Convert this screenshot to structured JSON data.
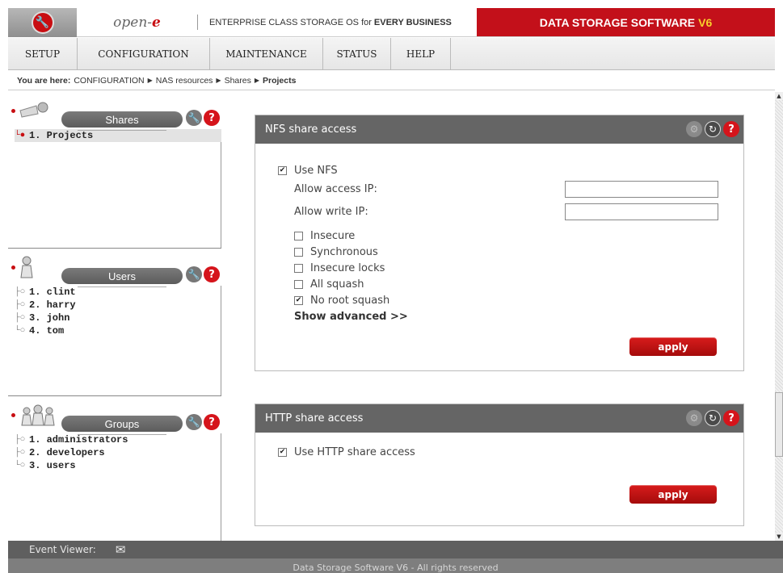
{
  "header": {
    "brand_text": "open-",
    "brand_e": "e",
    "tagline_prefix": "ENTERPRISE CLASS STORAGE OS for",
    "tagline_bold": "EVERY BUSINESS",
    "product": "DATA STORAGE SOFTWARE",
    "product_version": "V6"
  },
  "nav": {
    "items": [
      {
        "label": "SETUP"
      },
      {
        "label": "CONFIGURATION"
      },
      {
        "label": "MAINTENANCE"
      },
      {
        "label": "STATUS"
      },
      {
        "label": "HELP"
      }
    ]
  },
  "breadcrumb": {
    "prefix": "You are here:",
    "items": [
      "CONFIGURATION",
      "NAS resources",
      "Shares",
      "Projects"
    ]
  },
  "sidebar": {
    "shares": {
      "title": "Shares",
      "items": [
        {
          "label": "1. Projects"
        }
      ]
    },
    "users": {
      "title": "Users",
      "items": [
        {
          "label": "1. clint"
        },
        {
          "label": "2. harry"
        },
        {
          "label": "3. john"
        },
        {
          "label": "4. tom"
        }
      ]
    },
    "groups": {
      "title": "Groups",
      "items": [
        {
          "label": "1. administrators"
        },
        {
          "label": "2. developers"
        },
        {
          "label": "3. users"
        }
      ]
    }
  },
  "nfs": {
    "title": "NFS share access",
    "use_nfs": {
      "label": "Use NFS",
      "checked": true
    },
    "allow_access_ip": {
      "label": "Allow access IP:",
      "value": ""
    },
    "allow_write_ip": {
      "label": "Allow write IP:",
      "value": ""
    },
    "options": [
      {
        "label": "Insecure",
        "checked": false
      },
      {
        "label": "Synchronous",
        "checked": false
      },
      {
        "label": "Insecure locks",
        "checked": false
      },
      {
        "label": "All squash",
        "checked": false
      },
      {
        "label": "No root squash",
        "checked": true
      }
    ],
    "show_advanced": "Show advanced >>",
    "apply": "apply"
  },
  "http": {
    "title": "HTTP share access",
    "use_http": {
      "label": "Use HTTP share access",
      "checked": true
    },
    "apply": "apply"
  },
  "footer": {
    "event_viewer": "Event Viewer:",
    "copyright": "Data Storage Software V6 - All rights reserved"
  }
}
